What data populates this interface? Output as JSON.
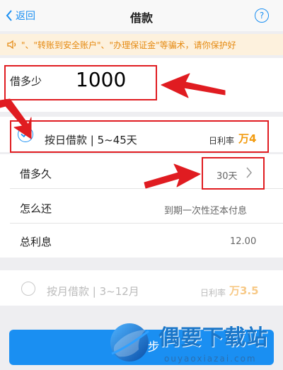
{
  "nav": {
    "back_label": "返回",
    "title": "借款",
    "help_symbol": "?"
  },
  "notice": {
    "text": "\"、\"转账到安全账户\"、\"办理保证金\"等骗术，请你保护好"
  },
  "amount": {
    "label": "借多少",
    "value": "1000"
  },
  "plan_daily": {
    "label": "按日借款 | 5~45天",
    "rate_label": "日利率",
    "rate_value": "万4"
  },
  "rows": [
    {
      "label": "借多久",
      "value": "30天"
    },
    {
      "label": "怎么还",
      "value": "到期一次性还本付息"
    },
    {
      "label": "总利息",
      "value": "12.00"
    }
  ],
  "plan_monthly": {
    "label": "按月借款 | 3~12月",
    "rate_label": "日利率",
    "rate_value": "万3.5"
  },
  "next_button": {
    "label": "下一步"
  },
  "watermark": {
    "text": "偶要下载站",
    "url": "ouyaoxiazai.com"
  },
  "colors": {
    "accent": "#1a8ff2",
    "annotation": "#e01c21",
    "rate": "#f29b0f",
    "notice_bg": "#fdf1dd"
  }
}
